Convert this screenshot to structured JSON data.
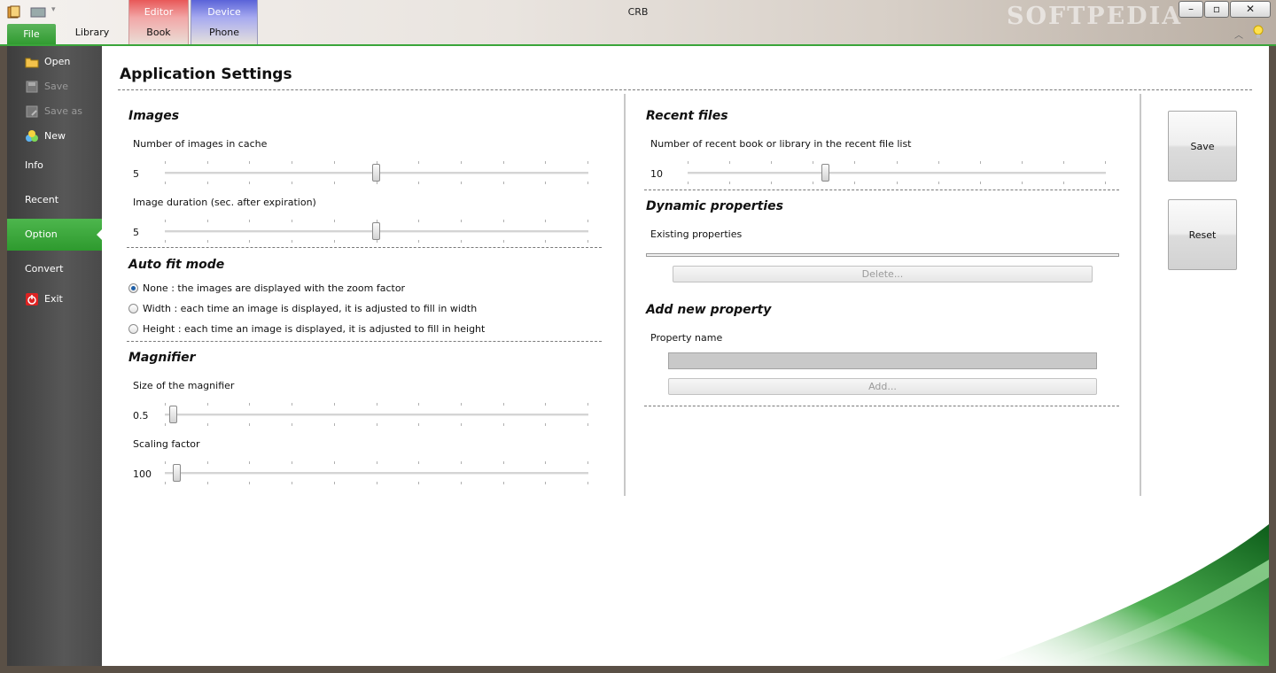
{
  "window": {
    "title": "CRB",
    "watermark": "SOFTPEDIA"
  },
  "ribbon": {
    "file_tab": "File",
    "library_tab": "Library",
    "contexts": [
      {
        "group": "Editor",
        "tab": "Book",
        "color": "#e85858"
      },
      {
        "group": "Device",
        "tab": "Phone",
        "color": "#5a63d8"
      }
    ]
  },
  "sidebar": {
    "items": [
      {
        "label": "Open",
        "icon": "folder-open-icon",
        "enabled": true
      },
      {
        "label": "Save",
        "icon": "save-icon",
        "enabled": false
      },
      {
        "label": "Save as",
        "icon": "save-as-icon",
        "enabled": false
      },
      {
        "label": "New",
        "icon": "new-icon",
        "enabled": true
      },
      {
        "label": "Info",
        "enabled": true
      },
      {
        "label": "Recent",
        "enabled": true
      },
      {
        "label": "Option",
        "enabled": true,
        "active": true
      },
      {
        "label": "Convert",
        "enabled": true
      },
      {
        "label": "Exit",
        "icon": "exit-icon",
        "enabled": true
      }
    ]
  },
  "page": {
    "title": "Application Settings"
  },
  "images": {
    "title": "Images",
    "cache_label": "Number of images in cache",
    "cache_value": "5",
    "cache_fraction": 0.5,
    "duration_label": "Image duration (sec. after expiration)",
    "duration_value": "5",
    "duration_fraction": 0.5
  },
  "autofit": {
    "title": "Auto fit mode",
    "options": [
      {
        "label": "None : the images are displayed with the zoom factor",
        "checked": true
      },
      {
        "label": "Width : each time an image is displayed, it is adjusted to fill in width",
        "checked": false
      },
      {
        "label": "Height : each time an image is displayed, it is adjusted to fill in height",
        "checked": false
      }
    ]
  },
  "magnifier": {
    "title": "Magnifier",
    "size_label": "Size of the magnifier",
    "size_value": "0.5",
    "size_fraction": 0.02,
    "scaling_label": "Scaling factor",
    "scaling_value": "100",
    "scaling_fraction": 0.03
  },
  "recent": {
    "title": "Recent files",
    "count_label": "Number of recent book or library in the recent file list",
    "count_value": "10",
    "count_fraction": 0.33
  },
  "dynamic": {
    "title": "Dynamic properties",
    "existing_label": "Existing properties",
    "delete_label": "Delete..."
  },
  "add_property": {
    "title": "Add new property",
    "name_label": "Property name",
    "name_value": "",
    "add_label": "Add..."
  },
  "actions": {
    "save_label": "Save",
    "reset_label": "Reset"
  }
}
